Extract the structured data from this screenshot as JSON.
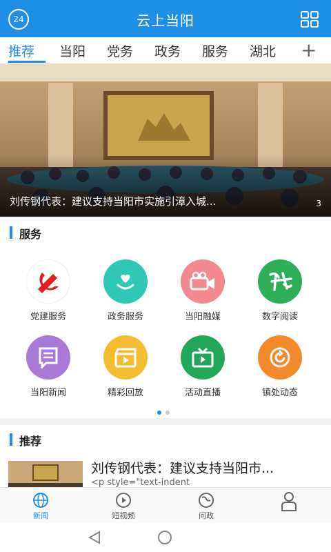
{
  "header": {
    "badge": "24",
    "title": "云上当阳",
    "menu_icon": "grid-icon"
  },
  "tabs": [
    {
      "label": "推荐",
      "active": true
    },
    {
      "label": "当阳"
    },
    {
      "label": "党务"
    },
    {
      "label": "政务"
    },
    {
      "label": "服务"
    },
    {
      "label": "湖北"
    }
  ],
  "tab_add": "+",
  "banner": {
    "title": "刘传钢代表：建议支持当阳市实施引漳入城...",
    "count": "3"
  },
  "services_section": {
    "title": "服务"
  },
  "services": [
    {
      "name": "党建服务",
      "color": "#ffffff",
      "icon": "party-emblem-icon"
    },
    {
      "name": "政务服务",
      "color": "#2fc8b4",
      "icon": "heart-hands-icon"
    },
    {
      "name": "当阳融媒",
      "color": "#f28a90",
      "icon": "video-camera-icon"
    },
    {
      "name": "数字阅读",
      "color": "#2fae5a",
      "icon": "calligraphy-icon"
    },
    {
      "name": "当阳新闻",
      "color": "#a77ad8",
      "icon": "message-icon"
    },
    {
      "name": "精彩回放",
      "color": "#f4bc30",
      "icon": "clapper-icon"
    },
    {
      "name": "活动直播",
      "color": "#22a65a",
      "icon": "tv-icon"
    },
    {
      "name": "镇处动态",
      "color": "#f28a2a",
      "icon": "refresh-icon"
    }
  ],
  "recommend_section": {
    "title": "推荐"
  },
  "news": [
    {
      "title": "刘传钢代表：建议支持当阳市...",
      "snippet": "<p style=\"text-indent"
    }
  ],
  "bottom_nav": [
    {
      "label": "新闻",
      "icon": "globe-icon",
      "active": true
    },
    {
      "label": "短视频",
      "icon": "play-icon"
    },
    {
      "label": "问政",
      "icon": "earth-icon"
    },
    {
      "label": "",
      "icon": "user-icon"
    }
  ]
}
